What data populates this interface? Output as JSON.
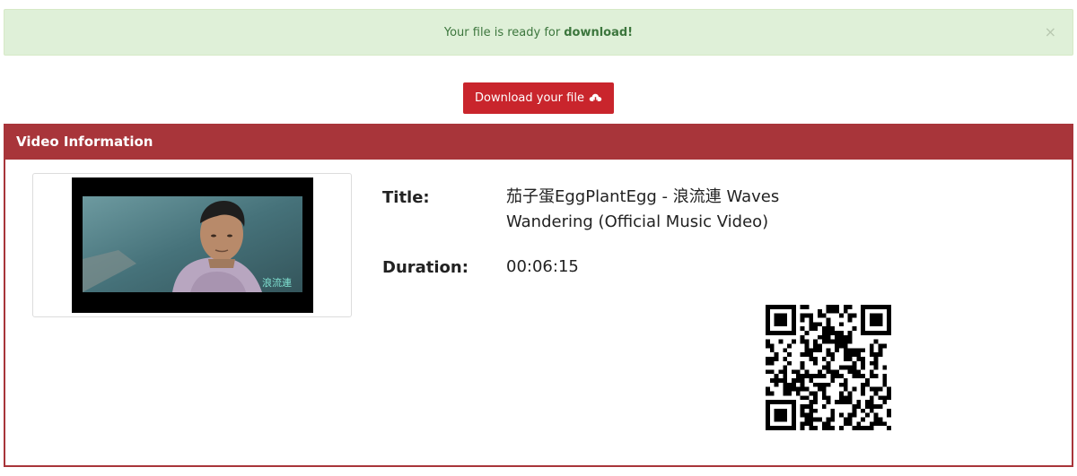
{
  "alert": {
    "message": "Your file is ready for",
    "emphasis": "download!",
    "close_label": "×"
  },
  "download_button": {
    "label": "Download your file",
    "icon": "cloud-download-icon",
    "color": "#c9252c"
  },
  "panel": {
    "heading": "Video Information",
    "header_color": "#a8353a"
  },
  "thumbnail": {
    "overlay_text": "浪流連"
  },
  "info": {
    "title_label": "Title:",
    "title_value": "茄子蛋EggPlantEgg - 浪流連 Waves Wandering (Official Music Video)",
    "duration_label": "Duration:",
    "duration_value": "00:06:15"
  },
  "qr_code": {
    "icon": "qr-code-icon"
  }
}
